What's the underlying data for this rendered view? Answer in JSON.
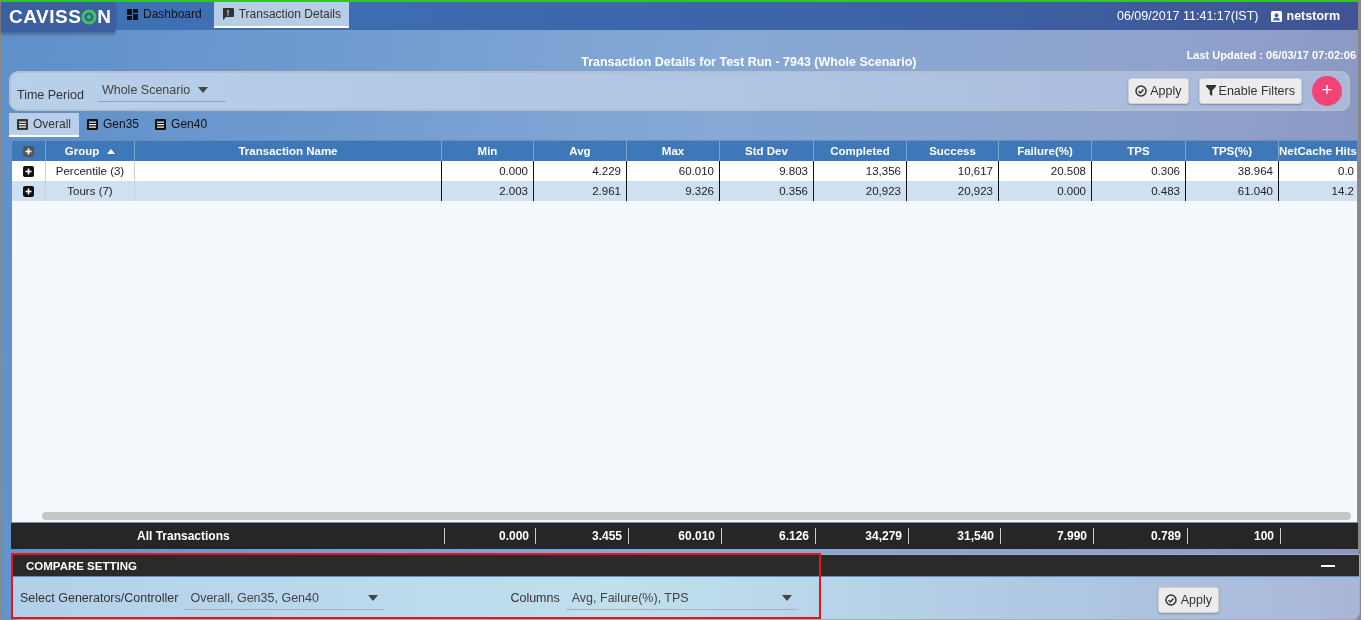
{
  "header": {
    "logo": {
      "before": "CAVISS",
      "after": "N"
    },
    "nav_tabs": [
      {
        "label": "Dashboard",
        "selected": false
      },
      {
        "label": "Transaction Details",
        "selected": true
      }
    ],
    "datetime": "06/09/2017 11:41:17(IST)",
    "user": "netstorm"
  },
  "page_title": "Transaction Details for Test Run - 7943 (Whole Scenario)",
  "last_updated": "Last Updated : 06/03/17 07:02:06",
  "filter_bar": {
    "time_period_label": "Time Period",
    "time_period_value": "Whole Scenario",
    "apply_button": "Apply",
    "filters_button": "Enable Filters",
    "add_button": "+"
  },
  "generator_tabs": [
    {
      "label": "Overall",
      "selected": true
    },
    {
      "label": "Gen35",
      "selected": false
    },
    {
      "label": "Gen40",
      "selected": false
    }
  ],
  "table": {
    "columns": [
      {
        "label": "Group",
        "sorted": true
      },
      {
        "label": "Transaction Name",
        "sorted": false
      },
      {
        "label": "Min",
        "sorted": false
      },
      {
        "label": "Avg",
        "sorted": false
      },
      {
        "label": "Max",
        "sorted": false
      },
      {
        "label": "Std Dev",
        "sorted": false
      },
      {
        "label": "Completed",
        "sorted": false
      },
      {
        "label": "Success",
        "sorted": false
      },
      {
        "label": "Failure(%)",
        "sorted": false
      },
      {
        "label": "TPS",
        "sorted": false
      },
      {
        "label": "TPS(%)",
        "sorted": false
      },
      {
        "label": "NetCache Hits",
        "sorted": false
      }
    ],
    "rows": [
      {
        "expanded": false,
        "cells": [
          "Percentile (3)",
          "",
          "0.000",
          "4.229",
          "60.010",
          "9.803",
          "13,356",
          "10,617",
          "20.508",
          "0.306",
          "38.964",
          "0.0"
        ]
      },
      {
        "expanded": false,
        "cells": [
          "Tours (7)",
          "",
          "2.003",
          "2.961",
          "9.326",
          "0.356",
          "20,923",
          "20,923",
          "0.000",
          "0.483",
          "61.040",
          "14.2"
        ]
      }
    ],
    "totals": {
      "label": "All Transactions",
      "values": [
        "0.000",
        "3.455",
        "60.010",
        "6.126",
        "34,279",
        "31,540",
        "7.990",
        "0.789",
        "100"
      ]
    }
  },
  "compare_setting": {
    "title": "COMPARE SETTING",
    "expanded": true,
    "generators_label": "Select Generators/Controller",
    "generators_value": "Overall,  Gen35,  Gen40",
    "columns_label": "Columns",
    "columns_value": "Avg,  Failure(%),  TPS",
    "apply_button": "Apply",
    "highlighted": true
  }
}
